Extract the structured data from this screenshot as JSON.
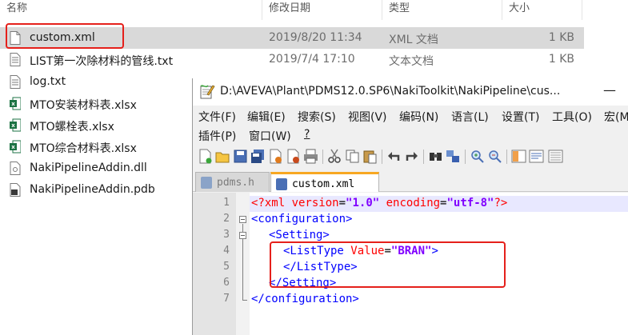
{
  "explorer": {
    "columns": [
      "名称",
      "修改日期",
      "类型",
      "大小"
    ],
    "files": [
      {
        "name": "custom.xml",
        "date": "2019/8/20 11:34",
        "type": "XML 文档",
        "size": "1 KB",
        "icon": "xml-file-icon",
        "selected": true
      },
      {
        "name": "LIST第一次除材料的管线.txt",
        "date": "2019/7/4 17:10",
        "type": "文本文档",
        "size": "1 KB",
        "icon": "text-file-icon",
        "selected": false
      },
      {
        "name": "log.txt",
        "date": "",
        "type": "",
        "size": "",
        "icon": "text-file-icon",
        "selected": false
      },
      {
        "name": "MTO安装材料表.xlsx",
        "date": "",
        "type": "",
        "size": "",
        "icon": "excel-file-icon",
        "selected": false
      },
      {
        "name": "MTO螺栓表.xlsx",
        "date": "",
        "type": "",
        "size": "",
        "icon": "excel-file-icon",
        "selected": false
      },
      {
        "name": "MTO综合材料表.xlsx",
        "date": "",
        "type": "",
        "size": "",
        "icon": "excel-file-icon",
        "selected": false
      },
      {
        "name": "NakiPipelineAddin.dll",
        "date": "",
        "type": "",
        "size": "",
        "icon": "dll-file-icon",
        "selected": false
      },
      {
        "name": "NakiPipelineAddin.pdb",
        "date": "",
        "type": "",
        "size": "",
        "icon": "pdb-file-icon",
        "selected": false
      }
    ]
  },
  "notepad": {
    "title": "D:\\AVEVA\\Plant\\PDMS12.0.SP6\\NakiToolkit\\NakiPipeline\\cus...",
    "minimize": "—",
    "menu_row1": [
      "文件(F)",
      "编辑(E)",
      "搜索(S)",
      "视图(V)",
      "编码(N)",
      "语言(L)",
      "设置(T)",
      "工具(O)",
      "宏(M"
    ],
    "menu_row2": [
      "插件(P)",
      "窗口(W)",
      "?"
    ],
    "tabs": [
      {
        "label": "pdms.h",
        "active": false
      },
      {
        "label": "custom.xml",
        "active": true
      }
    ],
    "line_numbers": [
      "1",
      "2",
      "3",
      "4",
      "5",
      "6",
      "7"
    ],
    "code": {
      "l1_open": "<?xml ",
      "l1_attr1": "version",
      "l1_eq1": "=",
      "l1_val1": "\"1.0\"",
      "l1_attr2": " encoding",
      "l1_eq2": "=",
      "l1_val2": "\"utf-8\"",
      "l1_close": "?>",
      "l2": "<configuration>",
      "l3": "<Setting>",
      "l4_tag": "<ListType ",
      "l4_attr": "Value",
      "l4_eq": "=",
      "l4_val": "\"BRAN\"",
      "l4_close": ">",
      "l5": "</ListType>",
      "l6": "</Setting>",
      "l7": "</configuration>"
    }
  },
  "colors": {
    "highlight_box": "#e5201b",
    "active_tab_accent": "#f7a722",
    "xml_tag": "#0000ff",
    "xml_attr": "#ff0000",
    "xml_value": "#8000ff"
  }
}
